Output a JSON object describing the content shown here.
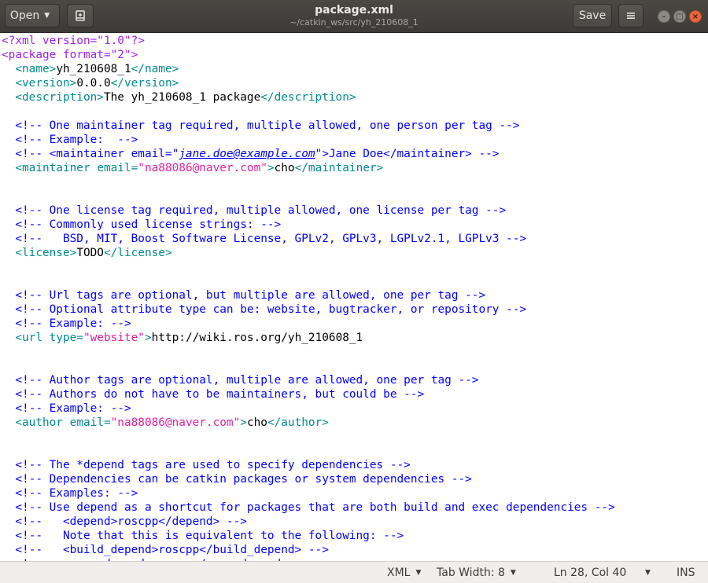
{
  "header": {
    "open_label": "Open",
    "pin_icon": "document-pin-icon",
    "title": "package.xml",
    "subtitle": "~/catkin_ws/src/yh_210608_1",
    "save_label": "Save",
    "menu_icon": "hamburger-menu-icon",
    "minimize_glyph": "–",
    "maximize_glyph": "□",
    "close_glyph": "×"
  },
  "editor": {
    "lines": [
      [
        [
          "pi",
          "<?xml version=\"1.0\"?>"
        ]
      ],
      [
        [
          "pi",
          "<package"
        ],
        [
          "txt",
          " "
        ],
        [
          "pi",
          "format=\"2\">"
        ]
      ],
      [
        [
          "txt",
          "  "
        ],
        [
          "tag",
          "<name>"
        ],
        [
          "txt",
          "yh_210608_1"
        ],
        [
          "tag",
          "</name>"
        ]
      ],
      [
        [
          "txt",
          "  "
        ],
        [
          "tag",
          "<version>"
        ],
        [
          "txt",
          "0.0.0"
        ],
        [
          "tag",
          "</version>"
        ]
      ],
      [
        [
          "txt",
          "  "
        ],
        [
          "tag",
          "<description>"
        ],
        [
          "txt",
          "The yh_210608_1 package"
        ],
        [
          "tag",
          "</description>"
        ]
      ],
      [],
      [
        [
          "txt",
          "  "
        ],
        [
          "cmt",
          "<!-- One maintainer tag required, multiple allowed, one person per tag -->"
        ]
      ],
      [
        [
          "txt",
          "  "
        ],
        [
          "cmt",
          "<!-- Example:  -->"
        ]
      ],
      [
        [
          "txt",
          "  "
        ],
        [
          "cmt",
          "<!-- <maintainer email=\""
        ],
        [
          "link",
          "jane.doe@example.com"
        ],
        [
          "cmt",
          "\">Jane Doe</maintainer> -->"
        ]
      ],
      [
        [
          "txt",
          "  "
        ],
        [
          "tag",
          "<maintainer"
        ],
        [
          "txt",
          " "
        ],
        [
          "attr",
          "email="
        ],
        [
          "str",
          "\"na88086@naver.com\""
        ],
        [
          "tag",
          ">"
        ],
        [
          "txt",
          "cho"
        ],
        [
          "tag",
          "</maintainer>"
        ]
      ],
      [],
      [],
      [
        [
          "txt",
          "  "
        ],
        [
          "cmt",
          "<!-- One license tag required, multiple allowed, one license per tag -->"
        ]
      ],
      [
        [
          "txt",
          "  "
        ],
        [
          "cmt",
          "<!-- Commonly used license strings: -->"
        ]
      ],
      [
        [
          "txt",
          "  "
        ],
        [
          "cmt",
          "<!--   BSD, MIT, Boost Software License, GPLv2, GPLv3, LGPLv2.1, LGPLv3 -->"
        ]
      ],
      [
        [
          "txt",
          "  "
        ],
        [
          "tag",
          "<license>"
        ],
        [
          "txt",
          "TODO"
        ],
        [
          "tag",
          "</license>"
        ]
      ],
      [],
      [],
      [
        [
          "txt",
          "  "
        ],
        [
          "cmt",
          "<!-- Url tags are optional, but multiple are allowed, one per tag -->"
        ]
      ],
      [
        [
          "txt",
          "  "
        ],
        [
          "cmt",
          "<!-- Optional attribute type can be: website, bugtracker, or repository -->"
        ]
      ],
      [
        [
          "txt",
          "  "
        ],
        [
          "cmt",
          "<!-- Example: -->"
        ]
      ],
      [
        [
          "txt",
          "  "
        ],
        [
          "tag",
          "<url"
        ],
        [
          "txt",
          " "
        ],
        [
          "attr",
          "type="
        ],
        [
          "str",
          "\"website\""
        ],
        [
          "tag",
          ">"
        ],
        [
          "txt",
          "http://wiki.ros.org/yh_210608_1"
        ]
      ],
      [],
      [],
      [
        [
          "txt",
          "  "
        ],
        [
          "cmt",
          "<!-- Author tags are optional, multiple are allowed, one per tag -->"
        ]
      ],
      [
        [
          "txt",
          "  "
        ],
        [
          "cmt",
          "<!-- Authors do not have to be maintainers, but could be -->"
        ]
      ],
      [
        [
          "txt",
          "  "
        ],
        [
          "cmt",
          "<!-- Example: -->"
        ]
      ],
      [
        [
          "txt",
          "  "
        ],
        [
          "tag",
          "<author"
        ],
        [
          "txt",
          " "
        ],
        [
          "attr",
          "email="
        ],
        [
          "str",
          "\"na88086@naver.com\""
        ],
        [
          "tag",
          ">"
        ],
        [
          "txt",
          "cho"
        ],
        [
          "tag",
          "</author>"
        ]
      ],
      [],
      [],
      [
        [
          "txt",
          "  "
        ],
        [
          "cmt",
          "<!-- The *depend tags are used to specify dependencies -->"
        ]
      ],
      [
        [
          "txt",
          "  "
        ],
        [
          "cmt",
          "<!-- Dependencies can be catkin packages or system dependencies -->"
        ]
      ],
      [
        [
          "txt",
          "  "
        ],
        [
          "cmt",
          "<!-- Examples: -->"
        ]
      ],
      [
        [
          "txt",
          "  "
        ],
        [
          "cmt",
          "<!-- Use depend as a shortcut for packages that are both build and exec dependencies -->"
        ]
      ],
      [
        [
          "txt",
          "  "
        ],
        [
          "cmt",
          "<!--   <depend>roscpp</depend> -->"
        ]
      ],
      [
        [
          "txt",
          "  "
        ],
        [
          "cmt",
          "<!--   Note that this is equivalent to the following: -->"
        ]
      ],
      [
        [
          "txt",
          "  "
        ],
        [
          "cmt",
          "<!--   <build_depend>roscpp</build_depend> -->"
        ]
      ],
      [
        [
          "txt",
          "  "
        ],
        [
          "cmt",
          "<!--   <exec_depend>roscpp</exec_depend> -->"
        ]
      ]
    ]
  },
  "statusbar": {
    "language": "XML",
    "tab_width": "Tab Width: 8",
    "position": "Ln 28, Col 40",
    "mode": "INS"
  }
}
